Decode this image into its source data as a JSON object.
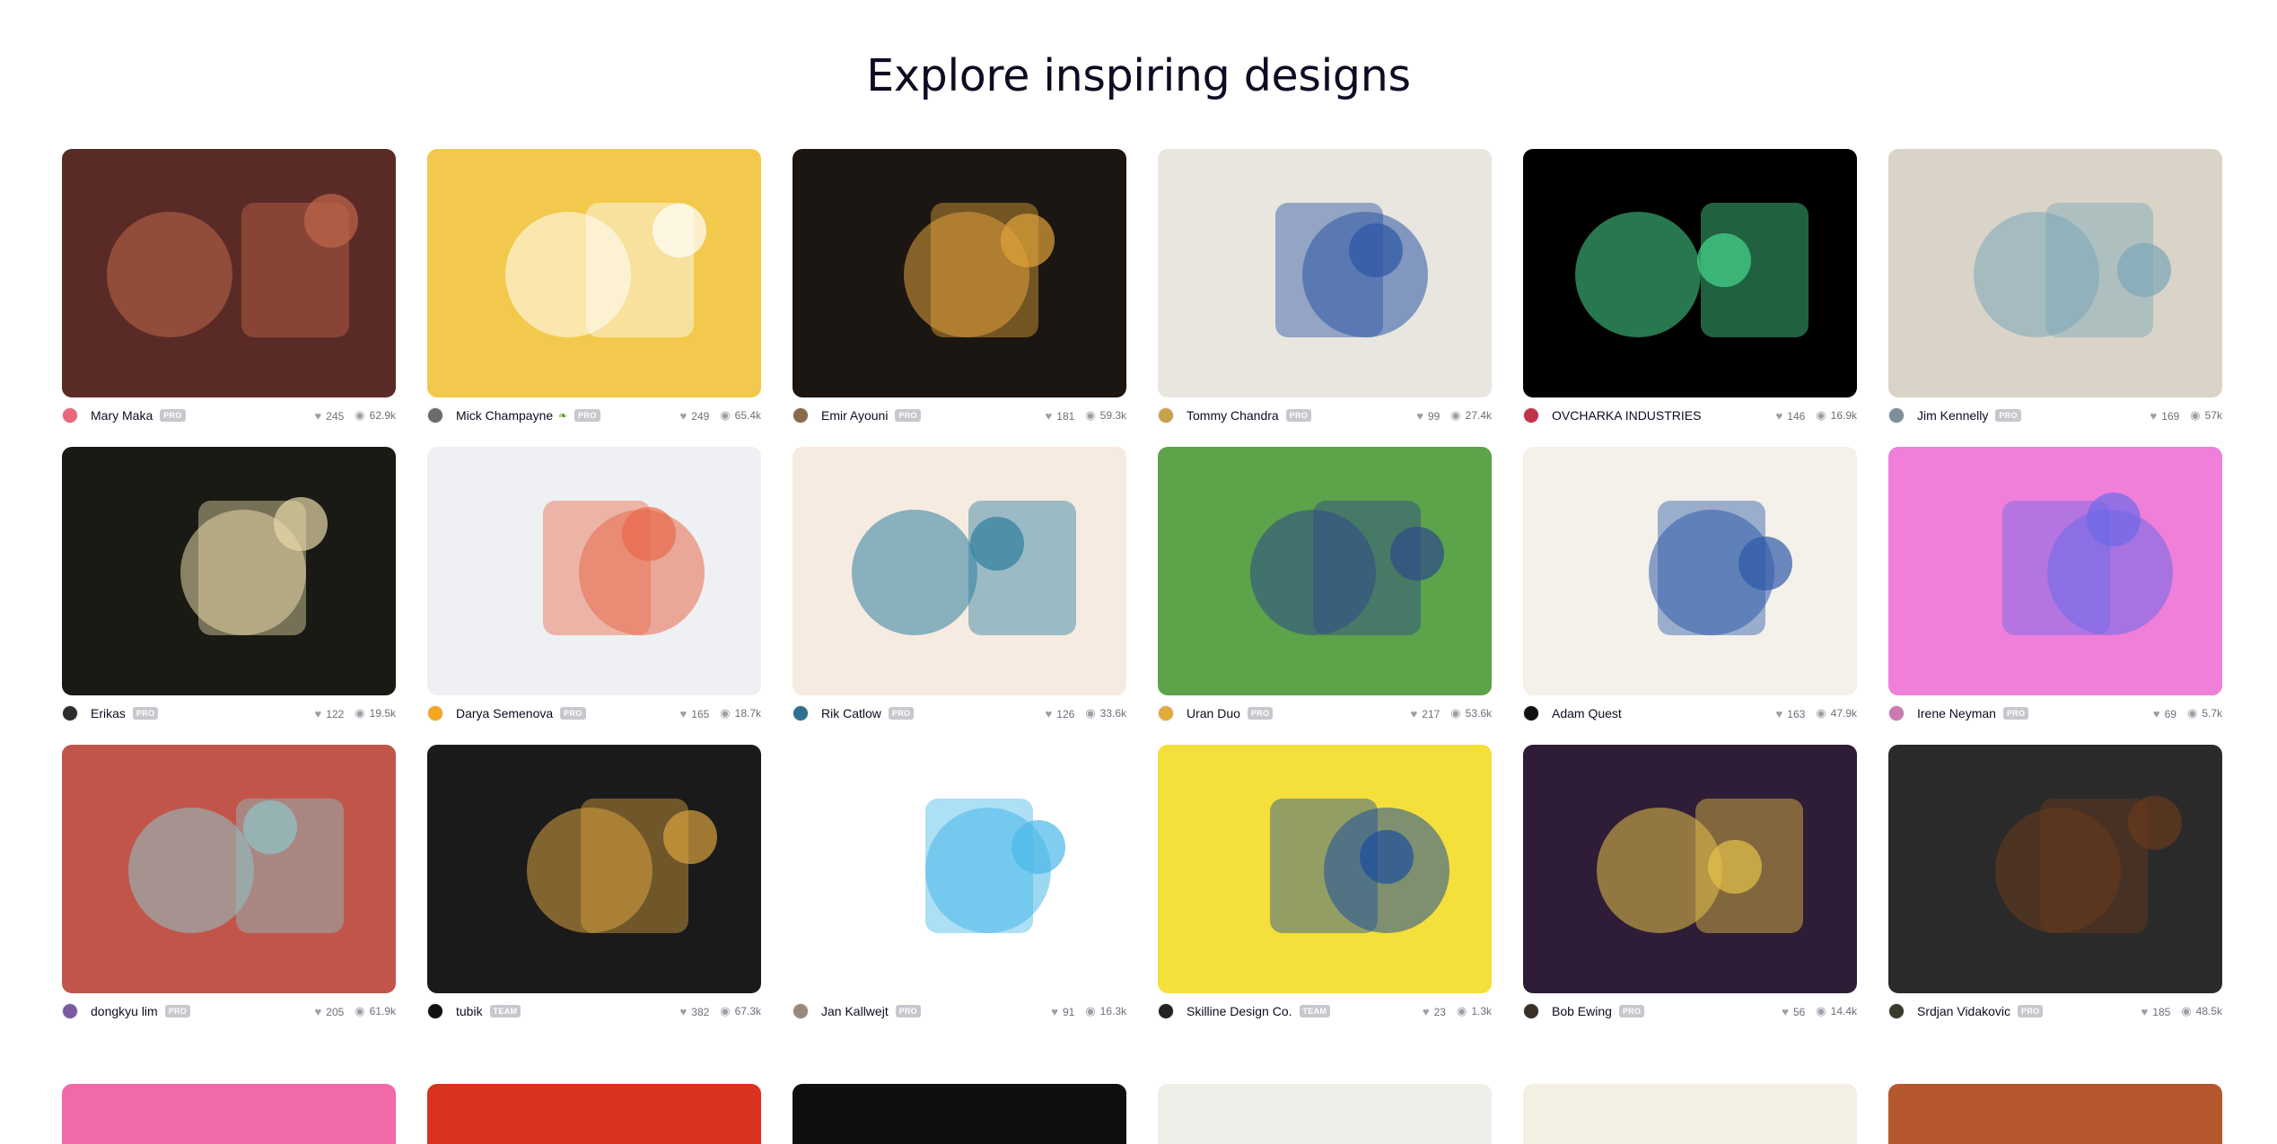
{
  "page": {
    "heading": "Explore inspiring designs"
  },
  "shots": [
    {
      "author": "Mary Maka",
      "badge": "PRO",
      "likes": "245",
      "views": "62.9k",
      "avatar_color": "#e8687a",
      "bg": "#5a2b26",
      "accent": "#c0674b"
    },
    {
      "author": "Mick Champayne",
      "badge": "PRO",
      "leaf": true,
      "likes": "249",
      "views": "65.4k",
      "avatar_color": "#6b6b6b",
      "bg": "#f2c94c",
      "accent": "#ffffff"
    },
    {
      "author": "Emir Ayouni",
      "badge": "PRO",
      "likes": "181",
      "views": "59.3k",
      "avatar_color": "#8a6a4c",
      "bg": "#1b1612",
      "accent": "#e0a23a"
    },
    {
      "author": "Tommy Chandra",
      "badge": "PRO",
      "likes": "99",
      "views": "27.4k",
      "avatar_color": "#c9a14c",
      "bg": "#e9e6df",
      "accent": "#2b55a5"
    },
    {
      "author": "OVCHARKA INDUSTRIES",
      "badge": "",
      "likes": "146",
      "views": "16.9k",
      "avatar_color": "#c2334a",
      "bg": "#000000",
      "accent": "#47d88f"
    },
    {
      "author": "Jim Kennelly",
      "badge": "PRO",
      "likes": "169",
      "views": "57k",
      "avatar_color": "#7c8f9b",
      "bg": "#d9d4c7",
      "accent": "#7aa6b8"
    },
    {
      "author": "Erikas",
      "badge": "PRO",
      "likes": "122",
      "views": "19.5k",
      "avatar_color": "#2d2d2d",
      "bg": "#1a1a14",
      "accent": "#e7d9a8"
    },
    {
      "author": "Darya Semenova",
      "badge": "PRO",
      "likes": "165",
      "views": "18.7k",
      "avatar_color": "#f5a623",
      "bg": "#eef0f3",
      "accent": "#e86a4b"
    },
    {
      "author": "Rik Catlow",
      "badge": "PRO",
      "likes": "126",
      "views": "33.6k",
      "avatar_color": "#2f6f8f",
      "bg": "#f6ebe0",
      "accent": "#2e7fa0"
    },
    {
      "author": "Uran Duo",
      "badge": "PRO",
      "likes": "217",
      "views": "53.6k",
      "avatar_color": "#e4a93b",
      "bg": "#5ca34a",
      "accent": "#2e4a8a"
    },
    {
      "author": "Adam Quest",
      "badge": "",
      "likes": "163",
      "views": "47.9k",
      "avatar_color": "#111111",
      "bg": "#f4f1ea",
      "accent": "#2f5aa8"
    },
    {
      "author": "Irene Neyman",
      "badge": "PRO",
      "likes": "69",
      "views": "5.7k",
      "avatar_color": "#c97ab0",
      "bg": "#f07fd9",
      "accent": "#6c6ae8"
    },
    {
      "author": "dongkyu lim",
      "badge": "PRO",
      "likes": "205",
      "views": "61.9k",
      "avatar_color": "#7a5aa0",
      "bg": "#c2554a",
      "accent": "#8fc4c8"
    },
    {
      "author": "tubik",
      "badge": "TEAM",
      "likes": "382",
      "views": "67.3k",
      "avatar_color": "#111111",
      "bg": "#1a1a1a",
      "accent": "#d9a23f"
    },
    {
      "author": "Jan Kallwejt",
      "badge": "PRO",
      "likes": "91",
      "views": "16.3k",
      "avatar_color": "#9a8a7c",
      "bg": "#ffffff",
      "accent": "#4ab8e8"
    },
    {
      "author": "Skilline Design Co.",
      "badge": "TEAM",
      "likes": "23",
      "views": "1.3k",
      "avatar_color": "#222222",
      "bg": "#f5df3a",
      "accent": "#1d4f9c"
    },
    {
      "author": "Bob Ewing",
      "badge": "PRO",
      "likes": "56",
      "views": "14.4k",
      "avatar_color": "#3b2f2a",
      "bg": "#2f1c36",
      "accent": "#e6c24a"
    },
    {
      "author": "Srdjan Vidakovic",
      "badge": "PRO",
      "likes": "185",
      "views": "48.5k",
      "avatar_color": "#3a3a2a",
      "bg": "#2a2a2a",
      "accent": "#6a3a1c"
    }
  ],
  "peek": [
    {
      "bg": "#f06aa8"
    },
    {
      "bg": "#d9321f"
    },
    {
      "bg": "#0f0f0f"
    },
    {
      "bg": "#efeee9"
    },
    {
      "bg": "#f3efe2"
    },
    {
      "bg": "#b5572c"
    }
  ],
  "icons": {
    "like": "heart-icon",
    "view": "eye-icon"
  }
}
